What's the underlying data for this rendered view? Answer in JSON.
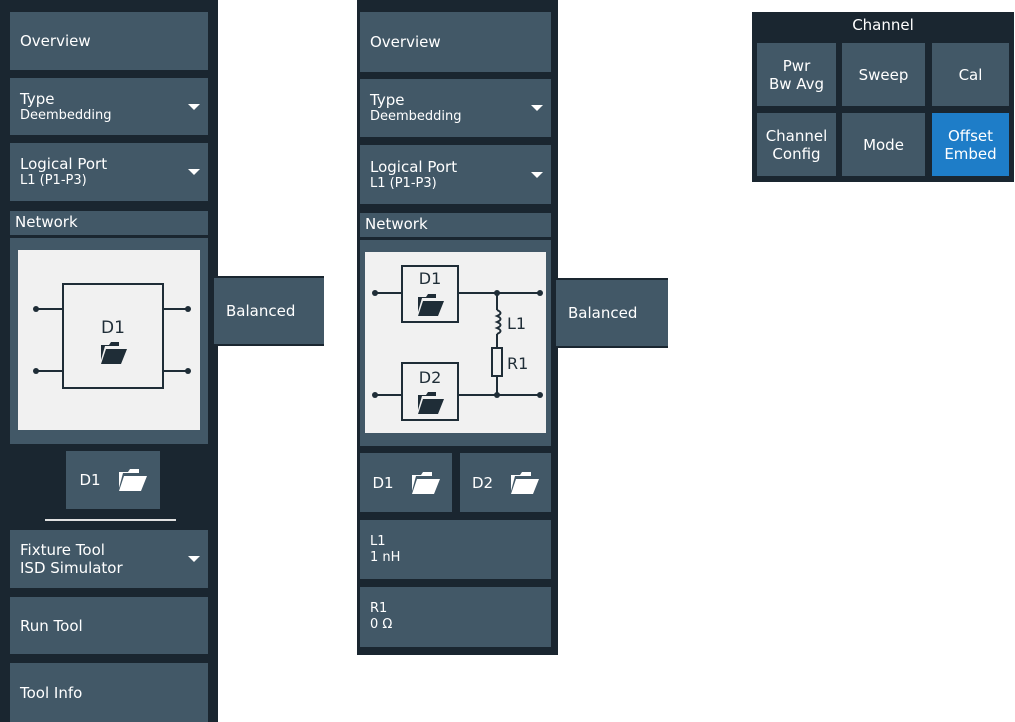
{
  "panel1": {
    "overview": "Overview",
    "type": {
      "label": "Type",
      "value": "Deembedding"
    },
    "logical_port": {
      "label": "Logical Port",
      "value": "L1 (P1-P3)"
    },
    "network_header": "Network",
    "diagram_box_label": "D1",
    "balanced_tab": "Balanced",
    "file_button": "D1",
    "fixture_tool": {
      "label": "Fixture Tool",
      "value": "ISD Simulator"
    },
    "run_tool": "Run Tool",
    "tool_info": "Tool Info"
  },
  "panel2": {
    "overview": "Overview",
    "type": {
      "label": "Type",
      "value": "Deembedding"
    },
    "logical_port": {
      "label": "Logical Port",
      "value": "L1 (P1-P3)"
    },
    "network_header": "Network",
    "diagram": {
      "d1": "D1",
      "d2": "D2",
      "inductor": "L1",
      "resistor": "R1"
    },
    "balanced_tab": "Balanced",
    "file_button_d1": "D1",
    "file_button_d2": "D2",
    "l1": {
      "label": "L1",
      "value": "1 nH"
    },
    "r1": {
      "label": "R1",
      "value": "0 Ω"
    }
  },
  "channel": {
    "title": "Channel",
    "buttons": [
      {
        "line1": "Pwr",
        "line2": "Bw Avg"
      },
      {
        "line1": "Sweep",
        "line2": ""
      },
      {
        "line1": "Cal",
        "line2": ""
      },
      {
        "line1": "Channel",
        "line2": "Config"
      },
      {
        "line1": "Mode",
        "line2": ""
      },
      {
        "line1": "Offset",
        "line2": "Embed"
      }
    ]
  },
  "colors": {
    "panel_bg": "#1a2630",
    "button_bg": "#425867",
    "active": "#1e7dc8"
  },
  "icons": [
    "caret-down-icon",
    "folder-open-icon"
  ]
}
